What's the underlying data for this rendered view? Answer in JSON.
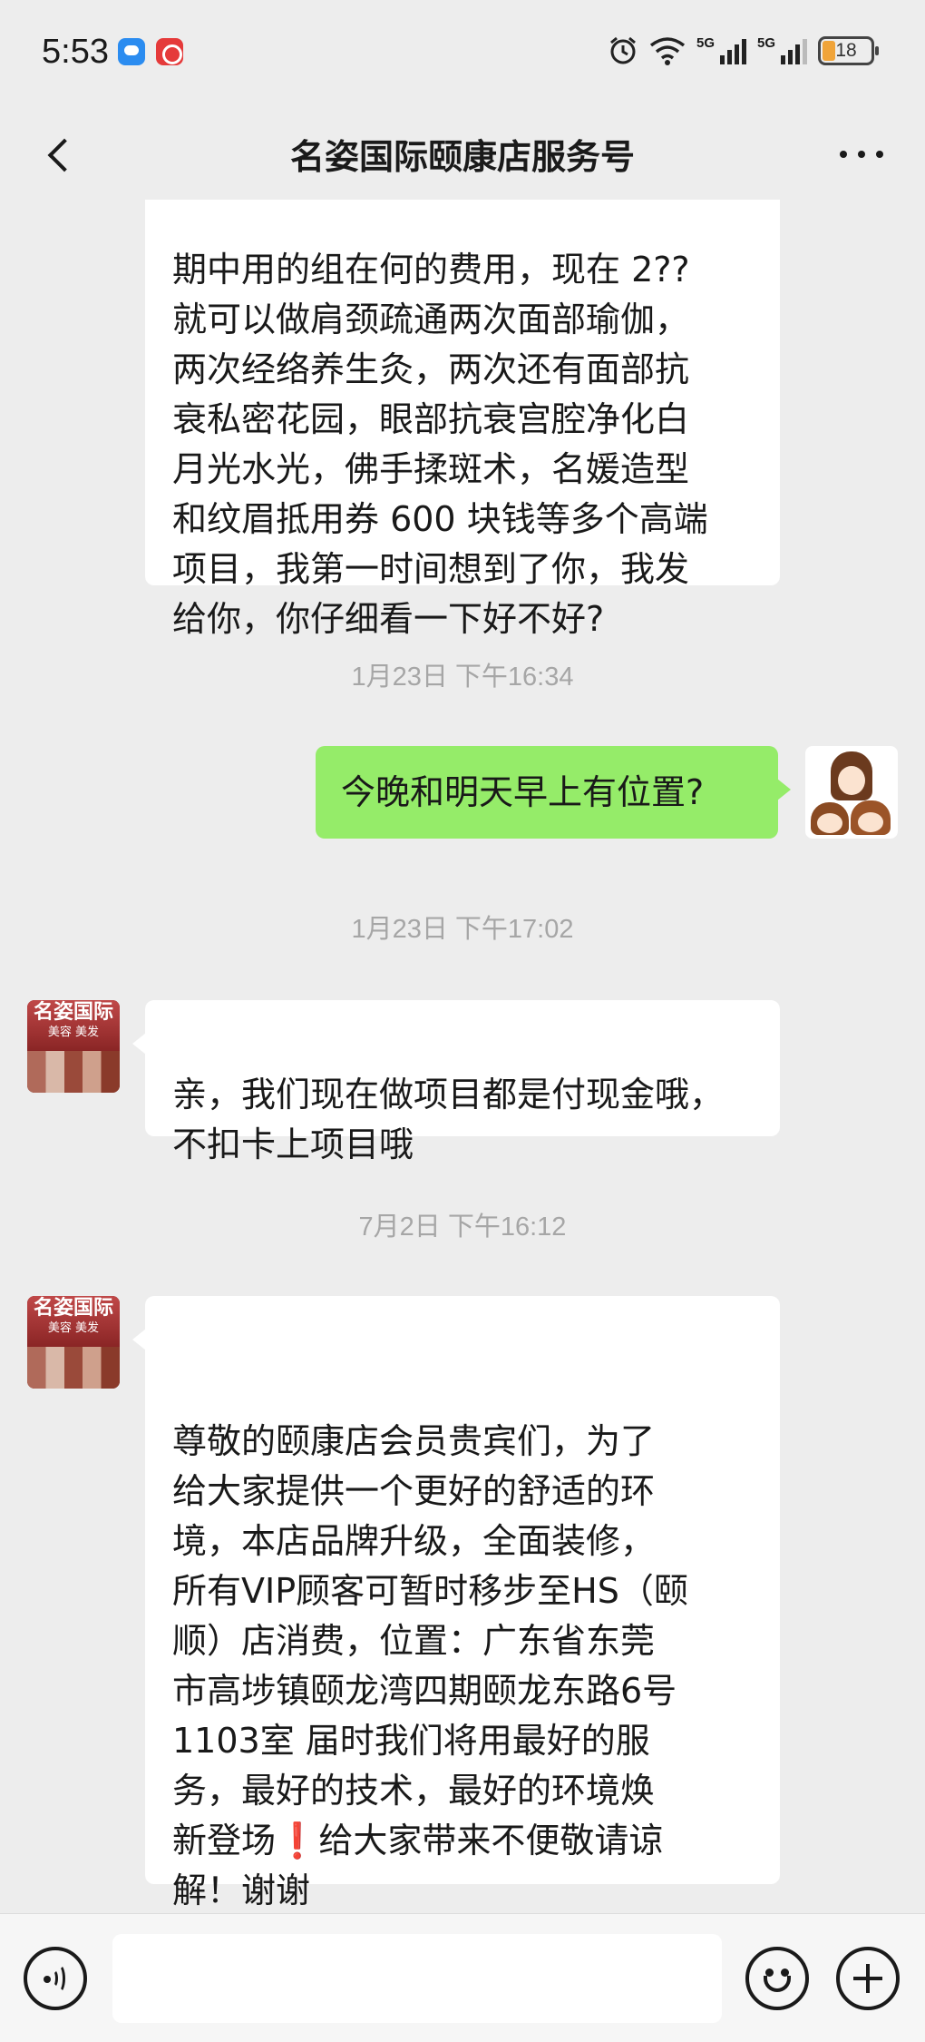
{
  "status_bar": {
    "time": "5:53",
    "signal_1": "5G",
    "signal_2": "5G",
    "battery": "18"
  },
  "header": {
    "title": "名姿国际颐康店服务号"
  },
  "messages": {
    "m1_text": "期中用的组在何的费用，现在 2??\n就可以做肩颈疏通两次面部瑜伽，\n两次经络养生灸，两次还有面部抗\n衰私密花园，眼部抗衰宫腔净化白\n月光水光，佛手揉斑术，名媛造型\n和纹眉抵用券 600 块钱等多个高端\n项目，我第一时间想到了你，我发\n给你，你仔细看一下好不好?",
    "ts1": "1月23日 下午16:34",
    "m2_text": "今晚和明天早上有位置?",
    "ts2": "1月23日 下午17:02",
    "m3_text": "亲，我们现在做项目都是付现金哦，\n不扣卡上项目哦",
    "ts3": "7月2日 下午16:12",
    "m4_text_a": "尊敬的颐康店会员贵宾们，为了\n给大家提供一个更好的舒适的环\n境，本店品牌升级，全面装修，\n所有VIP顾客可暂时移步至HS（颐\n顺）店消费，位置：广东省东莞\n市高埗镇颐龙湾四期颐龙东路6号\n1103室 届时我们将用最好的服\n务，最好的技术，最好的环境焕\n新登场",
    "m4_excl": "❗",
    "m4_text_b": "给大家带来不便敬请谅\n解！谢谢"
  },
  "avatars": {
    "store_sign": "名姿国际",
    "store_sign_sub": "美容 美发"
  },
  "input": {
    "value": ""
  }
}
